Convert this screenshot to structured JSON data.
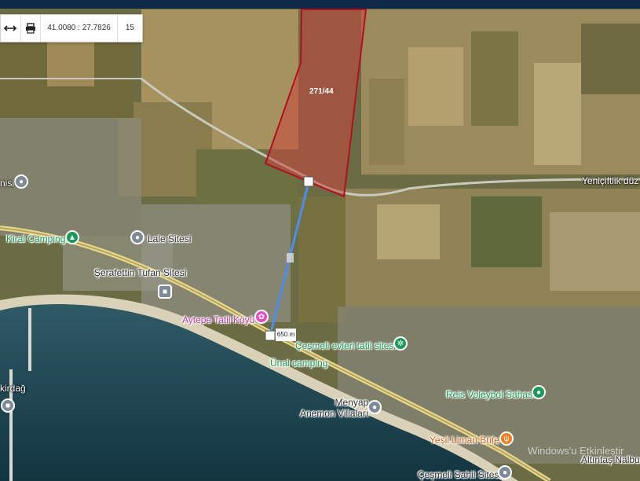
{
  "toolbar": {
    "measure_icon": "horizontal-arrows-icon",
    "print_icon": "printer-icon",
    "coordinates": "41.0080 : 27.7826",
    "zoom_level": "15"
  },
  "parcel": {
    "label": "271/44",
    "stroke_color": "#b01020",
    "fill_color": "#c8463e"
  },
  "measurement": {
    "distance": "650 m",
    "line_color": "#4a8ff0"
  },
  "places": [
    {
      "name": "Kiral Camping",
      "kind": "camping",
      "color": "#1a9a5a"
    },
    {
      "name": "Lale Sitesi",
      "kind": "place",
      "color": "#7f8a99"
    },
    {
      "name": "Şerafettin Tufan Sitesi",
      "kind": "place",
      "color": "#7f8a99"
    },
    {
      "name": "Aytepe Tatil Köyü",
      "kind": "resort",
      "color": "#e84cc0"
    },
    {
      "name": "Çeşmeli evleri tatil sitesi",
      "kind": "park",
      "color": "#1a9a5a"
    },
    {
      "name": "Ünal camping",
      "kind": "camping",
      "color": "#1a9a5a"
    },
    {
      "name": "Reis Voleybol Sahası",
      "kind": "sport",
      "color": "#1a9a5a"
    },
    {
      "name": "Menyap Anemon Villaları",
      "kind": "place",
      "color": "#7f8a99"
    },
    {
      "name": "Yeşil Liman Büfe",
      "kind": "food",
      "color": "#f07c1f"
    },
    {
      "name": "Altıntaş Nalbur",
      "kind": "shop",
      "color": "#7f8a99"
    },
    {
      "name": "Çeşmeli Sahil Sitesi",
      "kind": "place",
      "color": "#7f8a99"
    },
    {
      "name": "kirdağ",
      "kind": "city",
      "color": "#7f8a99"
    },
    {
      "name": "nisi",
      "kind": "place",
      "color": "#7f8a99"
    }
  ],
  "road": {
    "name": "Yeniçiftlik düz"
  },
  "watermark": "Windows'u Etkinleştir"
}
